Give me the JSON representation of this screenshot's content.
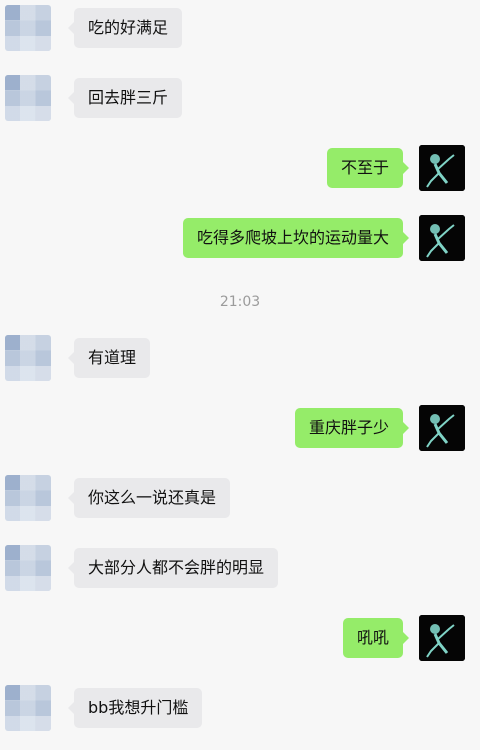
{
  "messages": [
    {
      "side": "left",
      "text": "吃的好满足"
    },
    {
      "side": "left",
      "text": "回去胖三斤"
    },
    {
      "side": "right",
      "text": "不至于"
    },
    {
      "side": "right",
      "text": "吃得多爬坡上坎的运动量大"
    },
    {
      "side": "left",
      "text": "有道理"
    },
    {
      "side": "right",
      "text": "重庆胖子少"
    },
    {
      "side": "left",
      "text": "你这么一说还真是"
    },
    {
      "side": "left",
      "text": "大部分人都不会胖的明显"
    },
    {
      "side": "right",
      "text": "吼吼"
    },
    {
      "side": "left",
      "text": "bb我想升门槛"
    }
  ],
  "timestamp": "21:03",
  "colors": {
    "self_bubble": "#95ec69",
    "other_bubble": "#e9e9eb",
    "background": "#f7f7f7",
    "timestamp_text": "#9b9b9b"
  },
  "avatars": {
    "other": "pixelated-avatar",
    "self": "x-ray-skeleton-avatar"
  }
}
